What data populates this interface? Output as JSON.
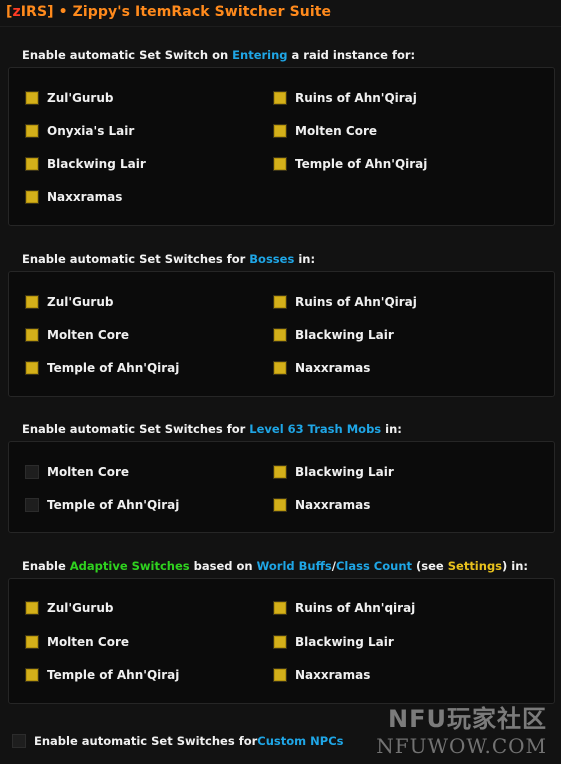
{
  "header": {
    "bracket_open": "[",
    "tag_z": "z",
    "tag_rest": "IRS]",
    "title_rest": " • Zippy's ItemRack Switcher Suite"
  },
  "colors": {
    "blue_accent": "#1fa6e6",
    "green_accent": "#2fd21f",
    "gold_accent": "#e8c11d",
    "title_orange": "#ff8a1c",
    "checkbox_gold": "#d4b01a"
  },
  "section_entering": {
    "label_pre": "Enable automatic Set Switch on ",
    "label_highlight": "Entering",
    "label_post": " a raid instance for:",
    "items": [
      {
        "label": "Zul'Gurub",
        "checked": true
      },
      {
        "label": "Ruins of Ahn'Qiraj",
        "checked": true
      },
      {
        "label": "Onyxia's Lair",
        "checked": true
      },
      {
        "label": "Molten Core",
        "checked": true
      },
      {
        "label": "Blackwing Lair",
        "checked": true
      },
      {
        "label": "Temple of Ahn'Qiraj",
        "checked": true
      },
      {
        "label": "Naxxramas",
        "checked": true
      }
    ]
  },
  "section_bosses": {
    "label_pre": "Enable automatic Set Switches for ",
    "label_highlight": "Bosses",
    "label_post": " in:",
    "items": [
      {
        "label": "Zul'Gurub",
        "checked": true
      },
      {
        "label": "Ruins of Ahn'Qiraj",
        "checked": true
      },
      {
        "label": "Molten Core",
        "checked": true
      },
      {
        "label": "Blackwing Lair",
        "checked": true
      },
      {
        "label": "Temple of Ahn'Qiraj",
        "checked": true
      },
      {
        "label": "Naxxramas",
        "checked": true
      }
    ]
  },
  "section_trash": {
    "label_pre": "Enable automatic Set Switches for ",
    "label_highlight": "Level 63 Trash Mobs",
    "label_post": " in:",
    "items": [
      {
        "label": "Molten Core",
        "checked": false
      },
      {
        "label": "Blackwing Lair",
        "checked": true
      },
      {
        "label": "Temple of Ahn'Qiraj",
        "checked": false
      },
      {
        "label": "Naxxramas",
        "checked": true
      }
    ]
  },
  "section_adaptive": {
    "label_1": "Enable ",
    "label_adaptive": "Adaptive Switches",
    "label_2": " based on ",
    "label_world_buffs": "World Buffs",
    "label_slash": "/",
    "label_class_count": "Class Count",
    "label_3": " (see ",
    "label_settings": "Settings",
    "label_4": ") in:",
    "items": [
      {
        "label": "Zul'Gurub",
        "checked": true
      },
      {
        "label": "Ruins of Ahn'qiraj",
        "checked": true
      },
      {
        "label": "Molten Core",
        "checked": true
      },
      {
        "label": "Blackwing Lair",
        "checked": true
      },
      {
        "label": "Temple of Ahn'Qiraj",
        "checked": true
      },
      {
        "label": "Naxxramas",
        "checked": true
      }
    ]
  },
  "custom_npcs": {
    "checked": false,
    "label_pre": "Enable automatic Set Switches for ",
    "label_highlight": "Custom NPCs"
  },
  "watermark": {
    "top": "NFU玩家社区",
    "bottom": "NFUWOW.COM"
  }
}
